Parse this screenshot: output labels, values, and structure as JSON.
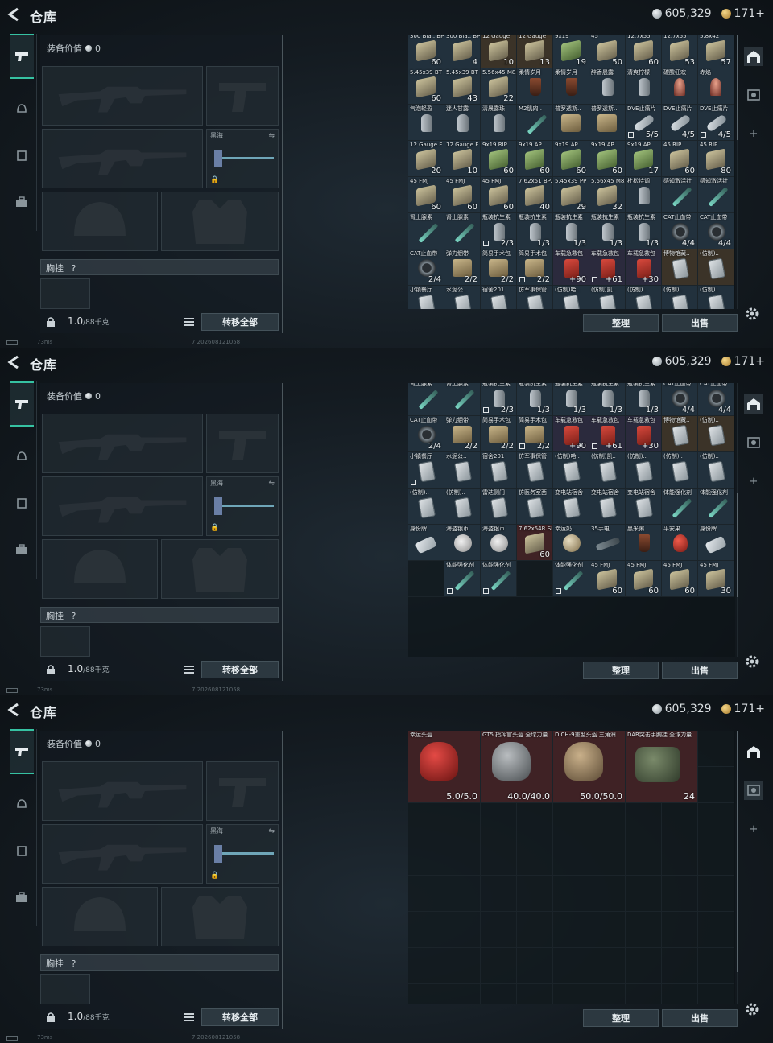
{
  "header": {
    "title": "仓库",
    "silver": "605,329",
    "gold": "171+"
  },
  "equip": {
    "value_label": "装备价值",
    "value": "0",
    "slot_black_sea": "黑海",
    "chest_label": "胸挂",
    "chest_help": "?",
    "weight": "1.0",
    "weight_unit": "/88千克",
    "transfer_all": "转移全部"
  },
  "actions": {
    "sort": "整理",
    "sell": "出售"
  },
  "status": {
    "ping": "73ms",
    "build": "7.202608121058"
  },
  "panels": [
    {
      "cells": [
        {
          "n": "300 Bla.. BP FMJ",
          "c": "60",
          "a": "ammo",
          "t": "blue"
        },
        {
          "n": "300 Bla.. BP FMJ",
          "c": "4",
          "a": "ammo",
          "t": "blue"
        },
        {
          "n": "12 Gauge",
          "c": "10",
          "a": "ammo",
          "t": "gold"
        },
        {
          "n": "12 Gauge",
          "c": "13",
          "a": "ammo",
          "t": "gold"
        },
        {
          "n": "9x19",
          "c": "19",
          "a": "ammog",
          "t": "blue"
        },
        {
          "n": "45",
          "c": "50",
          "a": "ammo",
          "t": "blue"
        },
        {
          "n": "12.7x55",
          "c": "60",
          "a": "ammo",
          "t": "blue"
        },
        {
          "n": "12.7x55",
          "c": "53",
          "a": "ammo",
          "t": "blue"
        },
        {
          "n": "5.8x42",
          "c": "57",
          "a": "ammo",
          "t": "blue"
        },
        {
          "n": "5.45x39 BT",
          "c": "60",
          "a": "ammo",
          "t": "blue"
        },
        {
          "n": "5.45x39 BT",
          "c": "43",
          "a": "ammo",
          "t": "blue"
        },
        {
          "n": "5.56x45 M855A1",
          "c": "22",
          "a": "ammo",
          "t": "blue"
        },
        {
          "n": "柔情岁月",
          "c": "",
          "a": "cup",
          "t": "blue"
        },
        {
          "n": "柔情岁月",
          "c": "",
          "a": "cup",
          "t": "blue"
        },
        {
          "n": "醉香晨露",
          "c": "",
          "a": "bottle",
          "t": "blue"
        },
        {
          "n": "清爽柠檬",
          "c": "",
          "a": "bottle",
          "t": "blue"
        },
        {
          "n": "碳酸狂欢",
          "c": "",
          "a": "glass",
          "t": "blue"
        },
        {
          "n": "赤焰",
          "c": "",
          "a": "glass",
          "t": "blue"
        },
        {
          "n": "气泡轻盈",
          "c": "",
          "a": "bottle",
          "t": "blue"
        },
        {
          "n": "迷人甘露",
          "c": "",
          "a": "bottle",
          "t": "blue"
        },
        {
          "n": "清晨露珠",
          "c": "",
          "a": "bottle",
          "t": "blue"
        },
        {
          "n": "M2肌肉..",
          "c": "",
          "a": "syringe",
          "t": "blue"
        },
        {
          "n": "普罗透斯..",
          "c": "",
          "a": "med",
          "t": "blue"
        },
        {
          "n": "普罗透斯..",
          "c": "",
          "a": "med",
          "t": "blue"
        },
        {
          "n": "DVE止痛片",
          "c": "5/5",
          "a": "pill",
          "t": "blue",
          "s": true
        },
        {
          "n": "DVE止痛片",
          "c": "4/5",
          "a": "pill",
          "t": "blue"
        },
        {
          "n": "DVE止痛片",
          "c": "4/5",
          "a": "pill",
          "t": "blue",
          "s": true
        },
        {
          "n": "12 Gauge F",
          "c": "20",
          "a": "ammo",
          "t": "blue"
        },
        {
          "n": "12 Gauge F",
          "c": "10",
          "a": "ammo",
          "t": "blue"
        },
        {
          "n": "9x19 RIP",
          "c": "60",
          "a": "ammog",
          "t": "blue"
        },
        {
          "n": "9x19 AP",
          "c": "60",
          "a": "ammog",
          "t": "blue"
        },
        {
          "n": "9x19 AP",
          "c": "60",
          "a": "ammog",
          "t": "blue"
        },
        {
          "n": "9x19 AP",
          "c": "60",
          "a": "ammog",
          "t": "blue"
        },
        {
          "n": "9x19 AP",
          "c": "17",
          "a": "ammog",
          "t": "blue"
        },
        {
          "n": "45 RIP",
          "c": "60",
          "a": "ammo",
          "t": "blue"
        },
        {
          "n": "45 RIP",
          "c": "80",
          "a": "ammo",
          "t": "blue"
        },
        {
          "n": "45 FMJ",
          "c": "60",
          "a": "ammo",
          "t": "blue"
        },
        {
          "n": "45 FMJ",
          "c": "60",
          "a": "ammo",
          "t": "blue"
        },
        {
          "n": "45 FMJ",
          "c": "60",
          "a": "ammo",
          "t": "blue"
        },
        {
          "n": "7.62x51 BPZ",
          "c": "40",
          "a": "ammo",
          "t": "blue"
        },
        {
          "n": "5.45x39 PP",
          "c": "29",
          "a": "ammo",
          "t": "blue"
        },
        {
          "n": "5.56x45 M855",
          "c": "32",
          "a": "ammo",
          "t": "blue"
        },
        {
          "n": "杜松特调",
          "c": "",
          "a": "bottle",
          "t": "blue"
        },
        {
          "n": "感知激活针",
          "c": "",
          "a": "syringe",
          "t": "blue"
        },
        {
          "n": "感知激活针",
          "c": "",
          "a": "syringe",
          "t": "blue"
        },
        {
          "n": "肾上腺素",
          "c": "",
          "a": "syringe",
          "t": "blue"
        },
        {
          "n": "肾上腺素",
          "c": "",
          "a": "syringe",
          "t": "blue"
        },
        {
          "n": "瓶装抗生素",
          "c": "2/3",
          "a": "bottle",
          "t": "blue",
          "s": true
        },
        {
          "n": "瓶装抗生素",
          "c": "1/3",
          "a": "bottle",
          "t": "blue"
        },
        {
          "n": "瓶装抗生素",
          "c": "1/3",
          "a": "bottle",
          "t": "blue"
        },
        {
          "n": "瓶装抗生素",
          "c": "1/3",
          "a": "bottle",
          "t": "blue"
        },
        {
          "n": "瓶装抗生素",
          "c": "1/3",
          "a": "bottle",
          "t": "blue"
        },
        {
          "n": "CAT止血带",
          "c": "4/4",
          "a": "tourniq",
          "t": "blue"
        },
        {
          "n": "CAT止血带",
          "c": "4/4",
          "a": "tourniq",
          "t": "blue"
        },
        {
          "n": "CAT止血带",
          "c": "2/4",
          "a": "tourniq",
          "t": "blue"
        },
        {
          "n": "弹力绷带",
          "c": "2/2",
          "a": "med",
          "t": "blue"
        },
        {
          "n": "简易手术包",
          "c": "2/2",
          "a": "med",
          "t": "blue"
        },
        {
          "n": "简易手术包",
          "c": "2/2",
          "a": "med",
          "t": "blue",
          "s": true
        },
        {
          "n": "车载急救包",
          "c": "+90",
          "a": "redbox",
          "t": "purple"
        },
        {
          "n": "车载急救包",
          "c": "+61",
          "a": "redbox",
          "t": "purple",
          "s": true
        },
        {
          "n": "车载急救包",
          "c": "+30",
          "a": "redbox",
          "t": "purple"
        },
        {
          "n": "博物馆藏..",
          "c": "",
          "a": "card",
          "t": "gold"
        },
        {
          "n": "(仿制)..",
          "c": "",
          "a": "card",
          "t": "gold"
        },
        {
          "n": "小镇餐厅",
          "c": "",
          "a": "card",
          "t": "blue"
        },
        {
          "n": "水泥公..",
          "c": "",
          "a": "card",
          "t": "blue"
        },
        {
          "n": "宿舍201",
          "c": "",
          "a": "card",
          "t": "blue"
        },
        {
          "n": "仿军事保管",
          "c": "",
          "a": "card",
          "t": "blue"
        },
        {
          "n": "(仿制)哈..",
          "c": "",
          "a": "card",
          "t": "blue"
        },
        {
          "n": "(仿制)凯..",
          "c": "",
          "a": "card",
          "t": "blue"
        },
        {
          "n": "(仿制)..",
          "c": "",
          "a": "card",
          "t": "blue"
        },
        {
          "n": "(仿制)..",
          "c": "",
          "a": "card",
          "t": "blue"
        },
        {
          "n": "(仿制)..",
          "c": "",
          "a": "card",
          "t": "blue"
        }
      ]
    },
    {
      "cells": [
        {
          "n": "肾上腺素",
          "c": "",
          "a": "syringe",
          "t": "blue"
        },
        {
          "n": "肾上腺素",
          "c": "",
          "a": "syringe",
          "t": "blue"
        },
        {
          "n": "瓶装抗生素",
          "c": "2/3",
          "a": "bottle",
          "t": "blue",
          "s": true
        },
        {
          "n": "瓶装抗生素",
          "c": "1/3",
          "a": "bottle",
          "t": "blue"
        },
        {
          "n": "瓶装抗生素",
          "c": "1/3",
          "a": "bottle",
          "t": "blue"
        },
        {
          "n": "瓶装抗生素",
          "c": "1/3",
          "a": "bottle",
          "t": "blue"
        },
        {
          "n": "瓶装抗生素",
          "c": "1/3",
          "a": "bottle",
          "t": "blue"
        },
        {
          "n": "CAT止血带",
          "c": "4/4",
          "a": "tourniq",
          "t": "blue"
        },
        {
          "n": "CAT止血带",
          "c": "4/4",
          "a": "tourniq",
          "t": "blue"
        },
        {
          "n": "CAT止血带",
          "c": "2/4",
          "a": "tourniq",
          "t": "blue"
        },
        {
          "n": "弹力绷带",
          "c": "2/2",
          "a": "med",
          "t": "blue"
        },
        {
          "n": "简易手术包",
          "c": "2/2",
          "a": "med",
          "t": "blue"
        },
        {
          "n": "简易手术包",
          "c": "2/2",
          "a": "med",
          "t": "blue",
          "s": true
        },
        {
          "n": "车载急救包",
          "c": "+90",
          "a": "redbox",
          "t": "purple"
        },
        {
          "n": "车载急救包",
          "c": "+61",
          "a": "redbox",
          "t": "purple",
          "s": true
        },
        {
          "n": "车载急救包",
          "c": "+30",
          "a": "redbox",
          "t": "purple"
        },
        {
          "n": "博物馆藏..",
          "c": "",
          "a": "card",
          "t": "gold"
        },
        {
          "n": "(仿制)..",
          "c": "",
          "a": "card",
          "t": "gold"
        },
        {
          "n": "小镇餐厅",
          "c": "",
          "a": "card",
          "t": "blue",
          "s": true
        },
        {
          "n": "水泥公..",
          "c": "",
          "a": "card",
          "t": "blue"
        },
        {
          "n": "宿舍201",
          "c": "",
          "a": "card",
          "t": "blue"
        },
        {
          "n": "仿军事保管",
          "c": "",
          "a": "card",
          "t": "blue"
        },
        {
          "n": "(仿制)哈..",
          "c": "",
          "a": "card",
          "t": "blue"
        },
        {
          "n": "(仿制)凯..",
          "c": "",
          "a": "card",
          "t": "blue"
        },
        {
          "n": "(仿制)..",
          "c": "",
          "a": "card",
          "t": "blue"
        },
        {
          "n": "(仿制)..",
          "c": "",
          "a": "card",
          "t": "blue"
        },
        {
          "n": "(仿制)..",
          "c": "",
          "a": "card",
          "t": "blue"
        },
        {
          "n": "(仿制)..",
          "c": "",
          "a": "card",
          "t": "blue"
        },
        {
          "n": "(仿制)..",
          "c": "",
          "a": "card",
          "t": "blue"
        },
        {
          "n": "雷达侧门",
          "c": "",
          "a": "card",
          "t": "blue"
        },
        {
          "n": "仿医务室西",
          "c": "",
          "a": "card",
          "t": "blue"
        },
        {
          "n": "变电站宿舍",
          "c": "",
          "a": "card",
          "t": "blue"
        },
        {
          "n": "变电站宿舍",
          "c": "",
          "a": "card",
          "t": "blue"
        },
        {
          "n": "变电站宿舍",
          "c": "",
          "a": "card",
          "t": "blue"
        },
        {
          "n": "体能强化剂",
          "c": "",
          "a": "syringe",
          "t": "blue"
        },
        {
          "n": "体能强化剂",
          "c": "",
          "a": "syringe",
          "t": "blue"
        },
        {
          "n": "身份牌",
          "c": "",
          "a": "tag",
          "t": "blue"
        },
        {
          "n": "海盗银币",
          "c": "",
          "a": "coinart",
          "t": "blue"
        },
        {
          "n": "海盗银币",
          "c": "",
          "a": "coinart",
          "t": "blue"
        },
        {
          "n": "7.62x54R SNB",
          "c": "60",
          "a": "ammo",
          "t": "red"
        },
        {
          "n": "幸运奶..",
          "c": "",
          "a": "ball",
          "t": "blue"
        },
        {
          "n": "35手电",
          "c": "",
          "a": "gun",
          "t": "blue"
        },
        {
          "n": "黑米粥",
          "c": "",
          "a": "cup",
          "t": "blue"
        },
        {
          "n": "平安果",
          "c": "",
          "a": "red",
          "t": "blue"
        },
        {
          "n": "身份牌",
          "c": "",
          "a": "tag",
          "t": "blue"
        },
        {
          "n": "",
          "c": "",
          "a": "",
          "t": "empty"
        },
        {
          "n": "体能强化剂",
          "c": "",
          "a": "syringe",
          "t": "blue",
          "s": true
        },
        {
          "n": "体能强化剂",
          "c": "",
          "a": "syringe",
          "t": "blue",
          "s": true
        },
        {
          "n": "",
          "c": "",
          "a": "",
          "t": "empty"
        },
        {
          "n": "体能强化剂",
          "c": "",
          "a": "syringe",
          "t": "blue",
          "s": true
        },
        {
          "n": "45 FMJ",
          "c": "60",
          "a": "ammo",
          "t": "blue"
        },
        {
          "n": "45 FMJ",
          "c": "60",
          "a": "ammo",
          "t": "blue"
        },
        {
          "n": "45 FMJ",
          "c": "60",
          "a": "ammo",
          "t": "blue"
        },
        {
          "n": "45 FMJ",
          "c": "30",
          "a": "ammo",
          "t": "blue"
        }
      ]
    },
    {
      "big_cells": [
        {
          "n": "幸运头盔",
          "c": "5.0/5.0",
          "a": "helmet red",
          "t": "red"
        },
        {
          "n": "GT5 指挥官头盔 全球力量",
          "c": "40.0/40.0",
          "a": "helmet grey",
          "t": "red"
        },
        {
          "n": "DICH-9重型头盔 三角洲",
          "c": "50.0/50.0",
          "a": "helmet tan",
          "t": "red"
        },
        {
          "n": "DAR突击手胸挂 全球力量",
          "c": "24",
          "a": "vest",
          "t": "red"
        }
      ]
    }
  ]
}
